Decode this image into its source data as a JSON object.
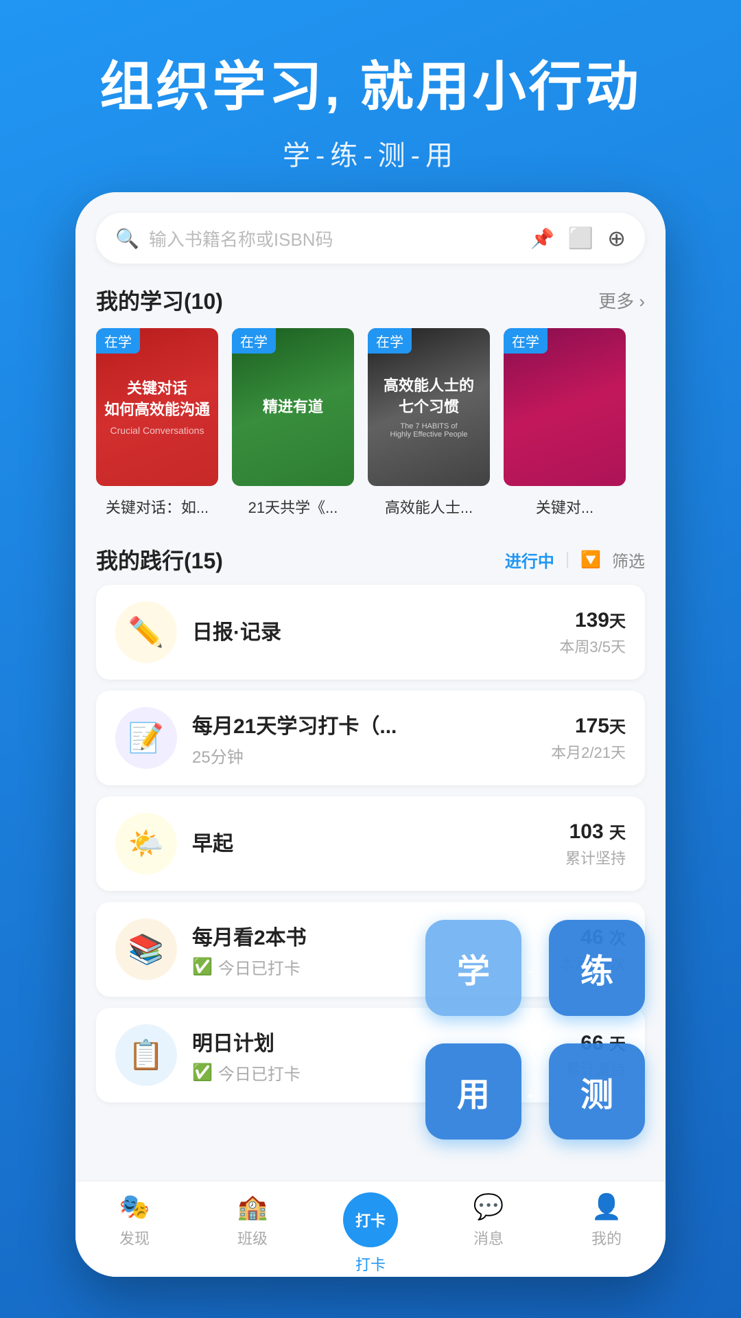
{
  "header": {
    "title": "组织学习, 就用小行动",
    "subtitle": "学-练-测-用"
  },
  "search": {
    "placeholder": "输入书籍名称或ISBN码"
  },
  "my_learning": {
    "section_title": "我的学习",
    "count": "(10)",
    "more_label": "更多 ›",
    "books": [
      {
        "tag": "在学",
        "title": "关键对话：如...",
        "cover_class": "cover-crucial",
        "text1": "关键对话",
        "text2": "如何高效能沟通",
        "text_en": "Crucial Conversations"
      },
      {
        "tag": "在学",
        "title": "21天共学《...",
        "cover_class": "cover-21days",
        "text1": "精进有道",
        "text2": "",
        "text_en": ""
      },
      {
        "tag": "在学",
        "title": "高效能人士...",
        "cover_class": "cover-7habits",
        "text1": "高效能人士的",
        "text2": "七个习惯",
        "text_en": "The 7 HABITS of Highly Effective People"
      },
      {
        "tag": "在学",
        "title": "关键对...",
        "cover_class": "cover-key2",
        "text1": "",
        "text2": "",
        "text_en": ""
      }
    ]
  },
  "my_practice": {
    "section_title": "我的践行",
    "count": "(15)",
    "filter_active": "进行中",
    "filter_divider": "|",
    "filter_label": "筛选",
    "items": [
      {
        "icon": "✏️",
        "icon_bg": "icon-bg-yellow",
        "name": "日报·记录",
        "sub": "",
        "days": "139",
        "days_unit": "天",
        "progress": "本周3/5天"
      },
      {
        "icon": "📝",
        "icon_bg": "icon-bg-purple",
        "name": "每月21天学习打卡（...",
        "sub": "25分钟",
        "days": "175",
        "days_unit": "天",
        "progress": "本月2/21天"
      },
      {
        "icon": "☀️",
        "icon_bg": "icon-bg-lightyellow",
        "name": "早起",
        "sub": "",
        "days": "103",
        "days_unit": " 天",
        "progress": "累计坚持"
      },
      {
        "icon": "📚",
        "icon_bg": "icon-bg-beige",
        "name": "每月看2本书",
        "sub_check": "今日已打卡",
        "days": "46",
        "days_unit": " 次",
        "progress": "本月1/2次"
      },
      {
        "icon": "📋",
        "icon_bg": "icon-bg-lightblue",
        "name": "明日计划",
        "sub_check": "今日已打卡",
        "days": "66",
        "days_unit": " 天",
        "progress": "累计坚持"
      }
    ]
  },
  "flow_buttons": [
    {
      "label": "学",
      "style": "light"
    },
    {
      "arrow": "→"
    },
    {
      "label": "练",
      "style": "dark"
    },
    {
      "arrow_down": "↓"
    },
    {
      "label": "用",
      "style": "dark"
    },
    {
      "arrow_left": "←"
    },
    {
      "label": "测",
      "style": "dark"
    }
  ],
  "bottom_nav": {
    "items": [
      {
        "icon": "🎭",
        "label": "发现",
        "active": false
      },
      {
        "icon": "🏫",
        "label": "班级",
        "active": false
      },
      {
        "icon": "打卡",
        "label": "打卡",
        "active": true
      },
      {
        "icon": "💬",
        "label": "消息",
        "active": false
      },
      {
        "icon": "👤",
        "label": "我的",
        "active": false
      }
    ]
  }
}
